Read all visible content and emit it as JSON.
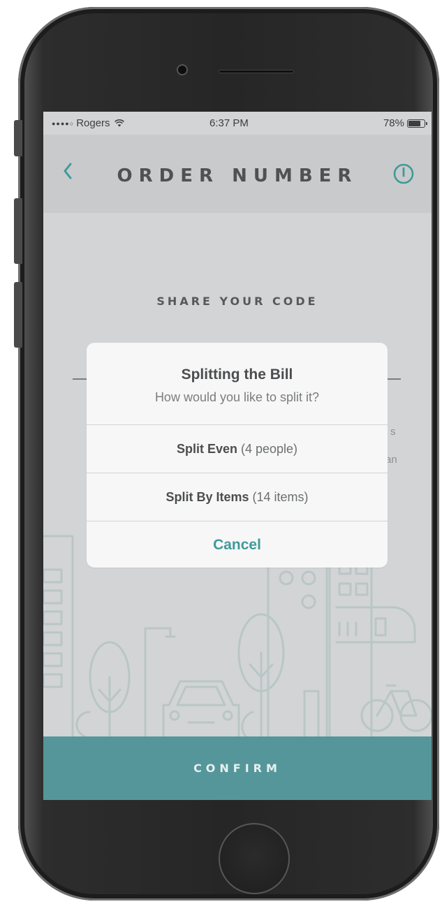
{
  "status_bar": {
    "signal": "●●●●○",
    "carrier": "Rogers",
    "time": "6:37 PM",
    "battery_percent": "78%",
    "battery_level": 0.78
  },
  "nav_bar": {
    "title": "ORDER NUMBER",
    "back_icon": "chevron-left-icon",
    "info_icon": "power-icon"
  },
  "content": {
    "section_title": "SHARE YOUR CODE",
    "partial_text": [
      "s",
      "an"
    ]
  },
  "dialog": {
    "title": "Splitting the Bill",
    "message": "How would you like to split it?",
    "actions": [
      {
        "label": "Split Even",
        "detail": "(4 people)"
      },
      {
        "label": "Split By Items",
        "detail": "(14 items)"
      }
    ],
    "cancel_label": "Cancel"
  },
  "footer": {
    "confirm_label": "CONFIRM"
  },
  "colors": {
    "accent": "#3f9a9a",
    "confirm_bar": "#55969a",
    "overlay": "#d3d4d6",
    "nav_bar": "#c9cacc",
    "dialog_background": "#f7f7f7"
  }
}
